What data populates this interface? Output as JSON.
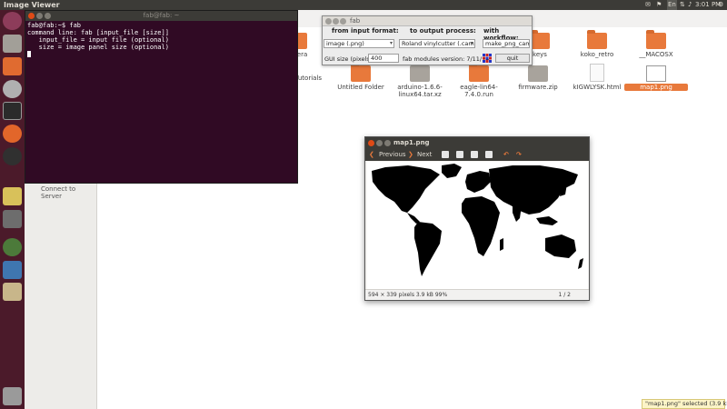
{
  "top_panel": {
    "app_title": "Image Viewer",
    "keyboard_layout": "En",
    "time": "3:01 PM"
  },
  "launcher": {
    "items": [
      "dash-home-icon",
      "files-icon",
      "software-center-icon",
      "system-settings-icon",
      "terminal-icon",
      "firefox-icon",
      "inkscape-icon",
      "libreoffice-impress-icon",
      "gimp-icon",
      "app-icon",
      "python-icon",
      "archive-icon",
      "trash-icon"
    ]
  },
  "files": {
    "sidebar_item": "Connect to Server",
    "icons": [
      {
        "name": "amera",
        "type": "folder"
      },
      {
        "name": "keys",
        "type": "folder"
      },
      {
        "name": "koko_retro",
        "type": "folder"
      },
      {
        "name": "__MACOSX",
        "type": "folder"
      },
      {
        "name": "p Tutorials",
        "type": "folder"
      },
      {
        "name": "Untitled Folder",
        "type": "folder"
      },
      {
        "name": "arduino-1.6.6-linux64.tar.xz",
        "type": "package"
      },
      {
        "name": "eagle-lin64-7.4.0.run",
        "type": "folder"
      },
      {
        "name": "firmware.zip",
        "type": "package"
      },
      {
        "name": "kIGWLYSK.html",
        "type": "document"
      },
      {
        "name": "map1.png",
        "type": "image"
      }
    ]
  },
  "terminal": {
    "title": "fab@fab: ~",
    "lines": [
      "fab@fab:~$ fab",
      "command line: fab [input_file [size]]",
      "   input_file = input file (optional)",
      "   size = image panel size (optional)"
    ]
  },
  "fab_dialog": {
    "title": "fab",
    "header_input": "from input format:",
    "header_output": "to output process:",
    "header_workflow": "with workflow:",
    "input_format": "image (.png)",
    "output_process": "Roland vinylcutter (.camm)",
    "workflow": "make_png_camm",
    "gui_size_label": "GUI size (pixels):",
    "gui_size_value": "400",
    "version_label": "fab modules version: 7/11/14",
    "quit_label": "quit"
  },
  "viewer": {
    "title": "map1.png",
    "prev_label": "Previous",
    "next_label": "Next",
    "status_info": "594 × 339 pixels  3.9 kB   99%",
    "page_counter": "1 / 2"
  },
  "notification": "\"map1.png\" selected  (3.9 kB)",
  "colors": {
    "accent": "#e8793b",
    "terminal_bg": "#300a24",
    "launcher_bg": "#4b1a2a",
    "panel_bg": "#3c3b37"
  }
}
